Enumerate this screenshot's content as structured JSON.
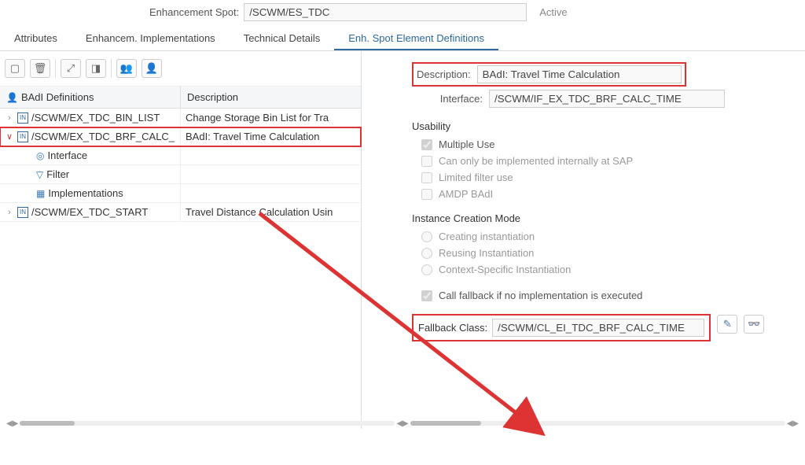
{
  "header": {
    "label": "Enhancement Spot:",
    "value": "/SCWM/ES_TDC",
    "status": "Active"
  },
  "tabs": {
    "attributes": "Attributes",
    "enhancem": "Enhancem. Implementations",
    "technical": "Technical Details",
    "definitions": "Enh. Spot Element Definitions"
  },
  "tree": {
    "header_left": "BAdI Definitions",
    "header_right": "Description",
    "rows": [
      {
        "name": "/SCWM/EX_TDC_BIN_LIST",
        "desc": "Change Storage Bin List for Tra",
        "level": 0,
        "expand": ">",
        "icon": "badi"
      },
      {
        "name": "/SCWM/EX_TDC_BRF_CALC_",
        "desc": "BAdI: Travel Time Calculation",
        "level": 0,
        "expand": "v",
        "icon": "badi",
        "hl": true
      },
      {
        "name": "Interface",
        "desc": "",
        "level": 1,
        "icon": "inter"
      },
      {
        "name": "Filter",
        "desc": "",
        "level": 1,
        "icon": "filter"
      },
      {
        "name": "Implementations",
        "desc": "",
        "level": 1,
        "icon": "impl"
      },
      {
        "name": "/SCWM/EX_TDC_START",
        "desc": "Travel Distance Calculation Usin",
        "level": 0,
        "expand": ">",
        "icon": "badi"
      }
    ]
  },
  "details": {
    "description_label": "Description:",
    "description_value": "BAdI: Travel Time Calculation",
    "interface_label": "Interface:",
    "interface_value": "/SCWM/IF_EX_TDC_BRF_CALC_TIME",
    "usability_title": "Usability",
    "usability": {
      "multiple": "Multiple Use",
      "internal": "Can only be implemented internally at SAP",
      "limited": "Limited filter use",
      "amdp": "AMDP BAdI"
    },
    "instance_title": "Instance Creation Mode",
    "instance": {
      "creating": "Creating instantiation",
      "reusing": "Reusing Instantiation",
      "context": "Context-Specific Instantiation"
    },
    "fallback_check": "Call fallback if no implementation is executed",
    "fallback_label": "Fallback Class:",
    "fallback_value": "/SCWM/CL_EI_TDC_BRF_CALC_TIME"
  }
}
